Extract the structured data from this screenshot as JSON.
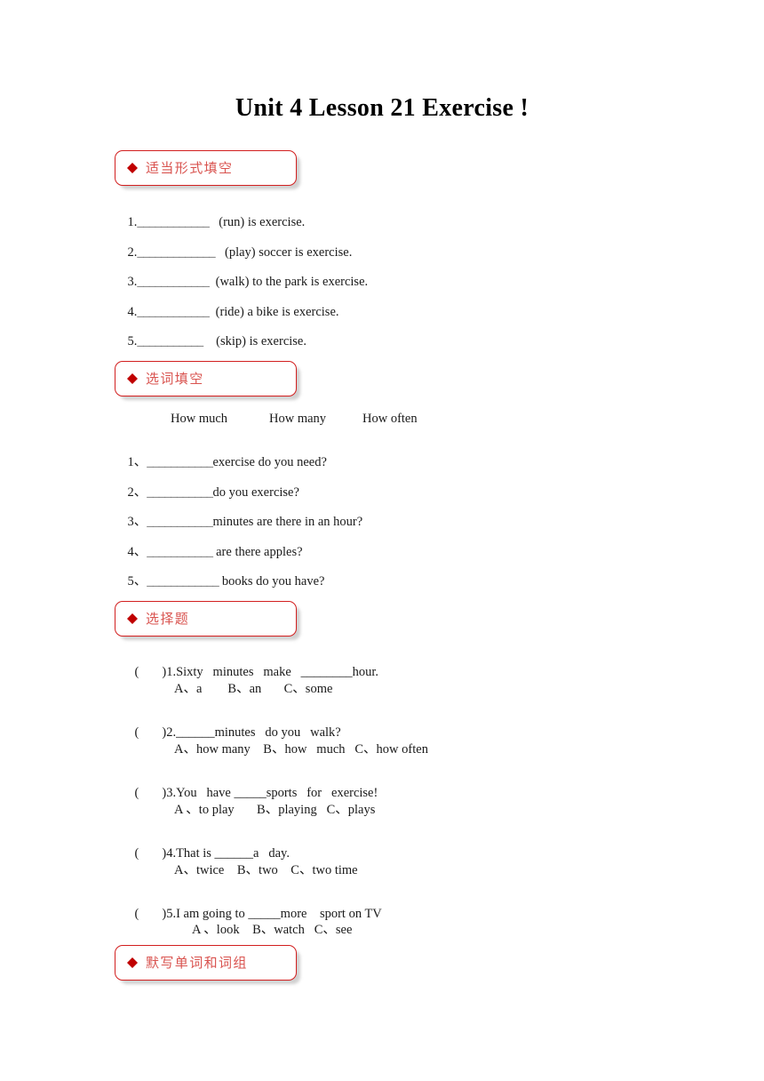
{
  "document": {
    "title": "Unit 4 Lesson 21 Exercise !"
  },
  "sections": [
    {
      "id": "fill-in-proper-form",
      "label": "适当形式填空",
      "bullet": "diamond",
      "items": [
        {
          "num": "1.",
          "blank": "____________",
          "text": "   (run) is exercise."
        },
        {
          "num": "2.",
          "blank": "_____________",
          "text": "   (play) soccer is exercise."
        },
        {
          "num": "3.",
          "blank": "____________",
          "text": "  (walk) to the park is exercise."
        },
        {
          "num": "4.",
          "blank": "____________",
          "text": "  (ride) a bike is exercise."
        },
        {
          "num": "5.",
          "blank": "___________",
          "text": "    (skip) is exercise."
        }
      ]
    },
    {
      "id": "choose-word-fill-blank",
      "label": "选词填空",
      "bullet": "diamond",
      "word_bank": [
        "How much",
        "How many",
        "How often"
      ],
      "items": [
        {
          "num": "1、",
          "blank": "___________",
          "text": "exercise do you need?"
        },
        {
          "num": "2、",
          "blank": "___________",
          "text": "do you exercise?"
        },
        {
          "num": "3、",
          "blank": "___________",
          "text": "minutes are there in an hour?"
        },
        {
          "num": "4、",
          "blank": "___________",
          "text": " are there apples?"
        },
        {
          "num": "5、",
          "blank": "____________",
          "text": " books do you have?"
        }
      ]
    },
    {
      "id": "multiple-choice",
      "label": "选择题",
      "bullet": "diamond",
      "questions": [
        {
          "bracket_open": "(",
          "bracket_close": ")",
          "stem": "1.Sixty   minutes   make   ________hour.",
          "options": "A、a        B、an       C、some"
        },
        {
          "bracket_open": "(",
          "bracket_close": ")",
          "stem": "2.______minutes   do you   walk?",
          "options": "A、how many    B、how   much   C、how often"
        },
        {
          "bracket_open": "(",
          "bracket_close": ")",
          "stem": "3.You   have _____sports   for   exercise!",
          "options": "A 、to play       B、playing   C、plays"
        },
        {
          "bracket_open": "(",
          "bracket_close": ")",
          "stem": "4.That is ______a   day.",
          "options": "A、twice    B、two    C、two time"
        },
        {
          "bracket_open": "(",
          "bracket_close": ")",
          "stem": "5.I am going to _____more    sport on TV",
          "options": "A 、look    B、watch   C、see"
        }
      ]
    },
    {
      "id": "dictation-words-phrases",
      "label": "默写单词和词组",
      "bullet": "diamond"
    }
  ],
  "colors": {
    "border_red": "#d21f1f",
    "label_red": "#d9534f",
    "diamond_red": "#c00000",
    "text_black": "#1a1a1a",
    "page_bg": "#ffffff"
  }
}
